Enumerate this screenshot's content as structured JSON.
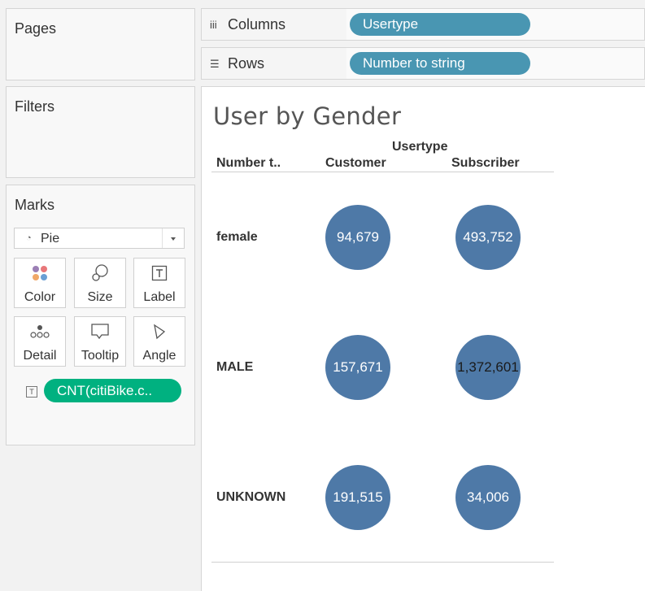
{
  "left_panel": {
    "pages_title": "Pages",
    "filters_title": "Filters",
    "marks": {
      "title": "Marks",
      "mark_type": "Pie",
      "buttons": [
        "Color",
        "Size",
        "Label",
        "Detail",
        "Tooltip",
        "Angle"
      ],
      "measure_pill": "CNT(citiBike.c.."
    }
  },
  "shelves": {
    "columns": {
      "name": "Columns",
      "pill": "Usertype"
    },
    "rows": {
      "name": "Rows",
      "pill": "Number to string"
    }
  },
  "view": {
    "title": "User by Gender",
    "column_group_header": "Usertype",
    "row_header_title": "Number t..",
    "columns": [
      "Customer",
      "Subscriber"
    ],
    "rows": [
      {
        "label": "female",
        "values": [
          "94,679",
          "493,752"
        ]
      },
      {
        "label": "MALE",
        "values": [
          "157,671",
          "1,372,601"
        ]
      },
      {
        "label": "UNKNOWN",
        "values": [
          "191,515",
          "34,006"
        ]
      }
    ],
    "mark_color": "#4e79a7"
  },
  "colors": {
    "dimension_pill": "#4996b2",
    "measure_pill": "#00b180"
  }
}
